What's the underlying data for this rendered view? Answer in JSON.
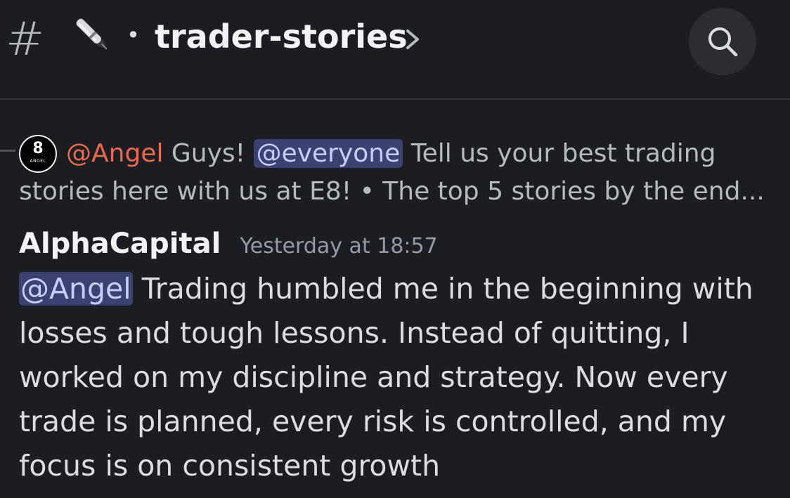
{
  "header": {
    "hash_symbol": "#",
    "separator": "•",
    "channel_name": "trader-stories",
    "icons": [
      "hash-icon",
      "pen-icon",
      "chevron-right-icon",
      "search-icon"
    ]
  },
  "reply": {
    "avatar_text": "ANGEL",
    "author": "@Angel",
    "text_before": "Guys!",
    "mention": "@everyone",
    "text_after": "Tell us your best trading",
    "line2": "stories here with us at E8!  • The top 5 stories by the end..."
  },
  "message": {
    "author": "AlphaCapital",
    "timestamp": "Yesterday at 18:57",
    "mention": "@Angel",
    "body": " Trading humbled me in the beginning with losses and tough lessons. Instead of quitting, I worked on my discipline and strategy. Now every trade is planned, every risk is controlled, and my focus is on consistent growth"
  },
  "colors": {
    "background": "#1c1d22",
    "mention_bg": "#3c4270",
    "mention_text": "#c9cdfb",
    "reply_author": "#e9694f"
  }
}
